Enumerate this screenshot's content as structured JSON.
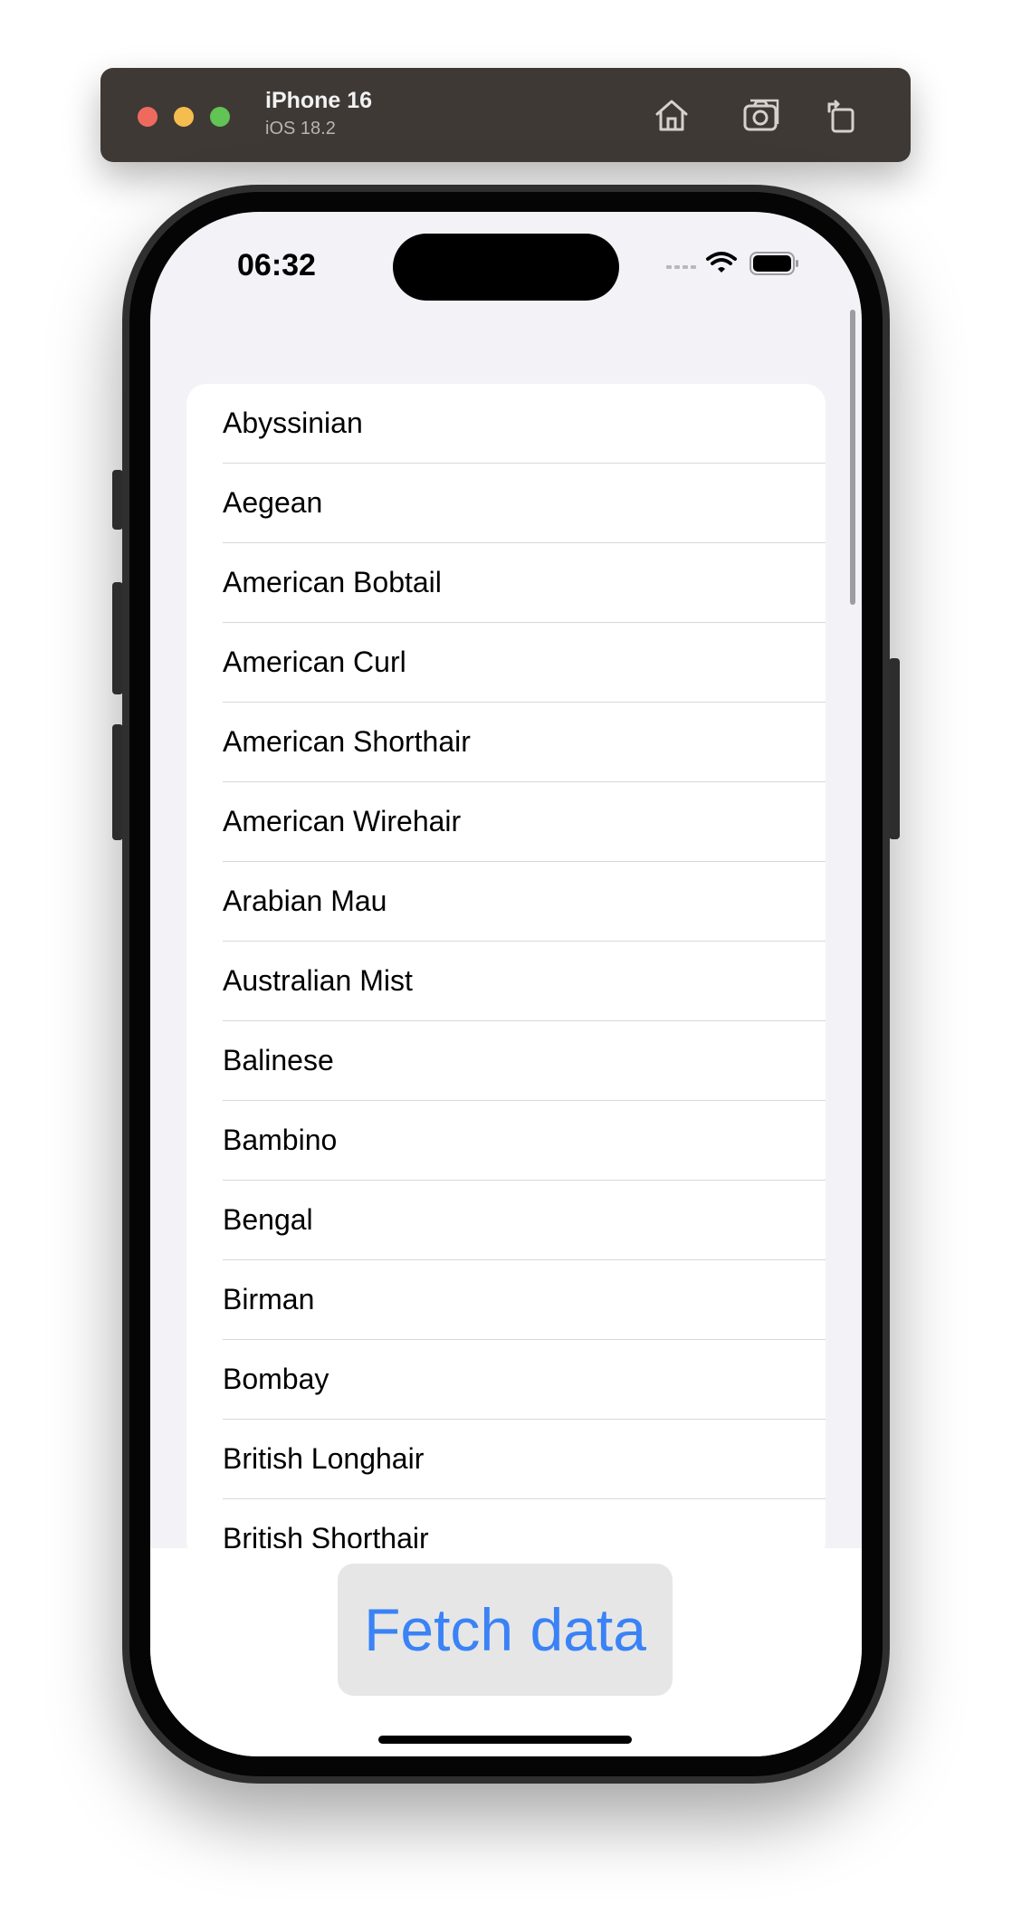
{
  "simulator": {
    "device_name": "iPhone 16",
    "os_version": "iOS 18.2",
    "toolbar_icons": [
      "home-icon",
      "screenshot-icon",
      "rotate-icon"
    ]
  },
  "status_bar": {
    "time": "06:32",
    "icons": [
      "cellular-icon",
      "wifi-icon",
      "battery-icon"
    ]
  },
  "breeds": [
    "Abyssinian",
    "Aegean",
    "American Bobtail",
    "American Curl",
    "American Shorthair",
    "American Wirehair",
    "Arabian Mau",
    "Australian Mist",
    "Balinese",
    "Bambino",
    "Bengal",
    "Birman",
    "Bombay",
    "British Longhair",
    "British Shorthair"
  ],
  "actions": {
    "fetch_label": "Fetch data"
  },
  "colors": {
    "accent": "#3a82f6",
    "screen_background": "#f2f2f7"
  }
}
